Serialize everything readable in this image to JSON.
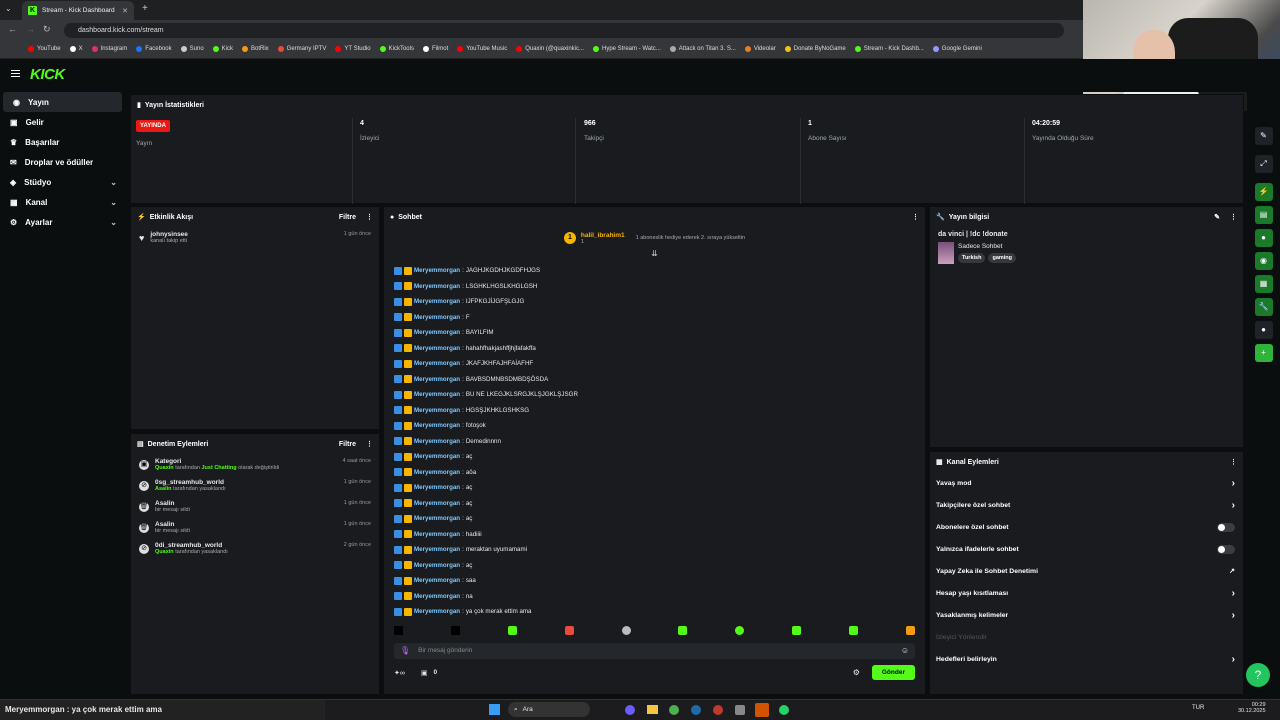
{
  "browser": {
    "tab_title": "Stream - Kick Dashboard",
    "url": "dashboard.kick.com/stream",
    "bookmarks": [
      {
        "label": "YouTube",
        "color": "#ff0000"
      },
      {
        "label": "X",
        "color": "#ffffff"
      },
      {
        "label": "Instagram",
        "color": "#e1306c"
      },
      {
        "label": "Facebook",
        "color": "#1877f2"
      },
      {
        "label": "Suno",
        "color": "#cccccc"
      },
      {
        "label": "Kick",
        "color": "#53fc18"
      },
      {
        "label": "BotRix",
        "color": "#f39c12"
      },
      {
        "label": "Germany IPTV",
        "color": "#e74c3c"
      },
      {
        "label": "YT Studio",
        "color": "#ff0000"
      },
      {
        "label": "KickTools",
        "color": "#53fc18"
      },
      {
        "label": "Filmot",
        "color": "#ffffff"
      },
      {
        "label": "YouTube Music",
        "color": "#ff0000"
      },
      {
        "label": "Quaxin (@quaxinkic...",
        "color": "#ff0000"
      },
      {
        "label": "Hype Stream - Watc...",
        "color": "#53fc18"
      },
      {
        "label": "Attack on Titan 3. S...",
        "color": "#aaaaaa"
      },
      {
        "label": "Videolar",
        "color": "#e67e22"
      },
      {
        "label": "Donate ByNoGame",
        "color": "#f1c40f"
      },
      {
        "label": "Stream - Kick Dashb...",
        "color": "#53fc18"
      },
      {
        "label": "Google Gemini",
        "color": "#8e9cff"
      }
    ]
  },
  "header": {
    "logo": "KICK"
  },
  "sidebar": {
    "items": [
      {
        "label": "Yayın",
        "icon": "broadcast-icon",
        "active": true,
        "expand": false
      },
      {
        "label": "Gelir",
        "icon": "money-icon",
        "expand": false
      },
      {
        "label": "Başarılar",
        "icon": "trophy-icon",
        "expand": false
      },
      {
        "label": "Droplar ve ödüller",
        "icon": "gift-icon",
        "expand": false
      },
      {
        "label": "Stüdyo",
        "icon": "studio-icon",
        "expand": true
      },
      {
        "label": "Kanal",
        "icon": "channel-icon",
        "expand": true
      },
      {
        "label": "Ayarlar",
        "icon": "gear-icon",
        "expand": true
      }
    ]
  },
  "stats": {
    "title": "Yayın İstatistikleri",
    "live_badge": "YAYINDA",
    "live_label": "Yayın",
    "items": [
      {
        "value": "4",
        "label": "İzleyici"
      },
      {
        "value": "966",
        "label": "Takipçi"
      },
      {
        "value": "1",
        "label": "Abone Sayısı"
      },
      {
        "value": "04:20:59",
        "label": "Yayında Olduğu Süre"
      }
    ]
  },
  "activity": {
    "title": "Etkinlik Akışı",
    "filter": "Filtre",
    "items": [
      {
        "user": "johnysinsee",
        "desc": "kanalı takip etti",
        "time": "1 gün önce"
      }
    ]
  },
  "moderation": {
    "title": "Denetim Eylemleri",
    "filter": "Filtre",
    "items": [
      {
        "title": "Kategori",
        "actor": "Quaxin",
        "text": "tarafından",
        "highlight": "Just Chatting",
        "rest": "olarak değiştirildi",
        "time": "4 saat önce",
        "icon": "category-icon"
      },
      {
        "title": "0sg_streamhub_world",
        "actor": "Asalin",
        "text": "tarafından yasaklandı",
        "highlight": "",
        "rest": "",
        "time": "1 gün önce",
        "icon": "ban-icon"
      },
      {
        "title": "Asalin",
        "actor": "",
        "text": "bir mesajı sildi",
        "highlight": "",
        "rest": "",
        "time": "1 gün önce",
        "icon": "trash-icon"
      },
      {
        "title": "Asalin",
        "actor": "",
        "text": "bir mesajı sildi",
        "highlight": "",
        "rest": "",
        "time": "1 gün önce",
        "icon": "trash-icon"
      },
      {
        "title": "0di_streamhub_world",
        "actor": "Quaxin",
        "text": "tarafından yasaklandı",
        "highlight": "",
        "rest": "",
        "time": "2 gün önce",
        "icon": "ban-icon"
      }
    ]
  },
  "chat": {
    "title": "Sohbet",
    "pinned_user": "halil_ibrahim1",
    "pinned_count": "1",
    "pinned_text": "1 aboneslik hediye ederek 2. sıraya yükseltin",
    "username": "Meryemmorgan",
    "messages": [
      "JAGHJKGDHJKGDFHJGS",
      "LSGHKLHGSLKHGLGSH",
      "IJFPKGJİJGFŞLGJG",
      "F",
      "BAYILFIM",
      "hahahfhakjashffjhjfafakffa",
      "JKAFJKHFAJHFAİAFHF",
      "BAVBSDMNBSDMBDŞÖSDA",
      "BU NE LKEGJKLSRGJKLŞJGKLŞJSGR",
      "HGSŞJKHKLGSHKSG",
      "fotoşok",
      "Demedinnnn",
      "aç",
      "aöa",
      "aç",
      "aç",
      "aç",
      "hadiiii",
      "meraktan uyumamami",
      "aç",
      "saa",
      "na",
      "ya çok merak ettim ama"
    ],
    "input_placeholder": "Bir mesaj gönderin",
    "points": "0",
    "send": "Gönder"
  },
  "stream_info": {
    "title": "Yayın bilgisi",
    "stream_title": "da vinci | !dc !donate",
    "category": "Sadece Sohbet",
    "tags": [
      "Turkish",
      "gaming"
    ]
  },
  "channel_actions": {
    "title": "Kanal Eylemleri",
    "items": [
      {
        "label": "Yavaş mod",
        "control": "arrow"
      },
      {
        "label": "Takipçilere özel sohbet",
        "control": "arrow"
      },
      {
        "label": "Abonelere özel sohbet",
        "control": "toggle"
      },
      {
        "label": "Yalnızca ifadelerle sohbet",
        "control": "toggle"
      },
      {
        "label": "Yapay Zeka ile Sohbet Denetimi",
        "control": "external"
      },
      {
        "label": "Hesap yaşı kısıtlaması",
        "control": "arrow"
      },
      {
        "label": "Yasaklanmış kelimeler",
        "control": "arrow"
      },
      {
        "label": "İzleyici Yönlendir",
        "control": "none",
        "disabled": true
      },
      {
        "label": "Hedefleri belirleyin",
        "control": "arrow"
      }
    ]
  },
  "taskbar": {
    "notice": "Meryemmorgan : ya çok merak ettim ama",
    "search": "Ara",
    "lang": "TUR",
    "time": "00:29",
    "date": "30.12.2025"
  },
  "colors": {
    "accent": "#53fc18",
    "live": "#e91916",
    "username": "#7cc8ff"
  }
}
